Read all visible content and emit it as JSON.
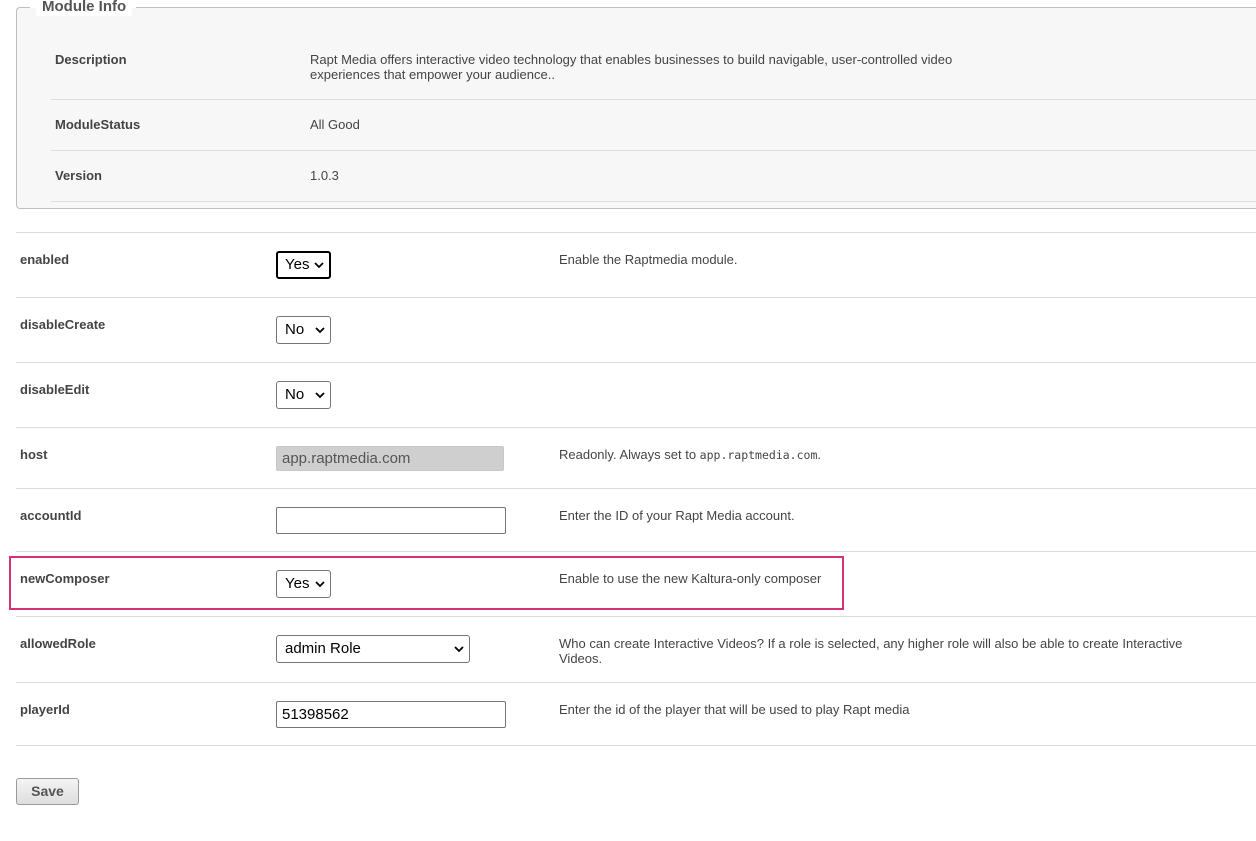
{
  "module_info": {
    "legend": "Module Info",
    "rows": [
      {
        "label": "Description",
        "value": "Rapt Media offers interactive video technology that enables businesses to build navigable, user-controlled video experiences that empower your audience.."
      },
      {
        "label": "ModuleStatus",
        "value": "All Good"
      },
      {
        "label": "Version",
        "value": "1.0.3"
      }
    ]
  },
  "settings": {
    "enabled": {
      "label": "enabled",
      "value": "Yes",
      "help": "Enable the Raptmedia module."
    },
    "disableCreate": {
      "label": "disableCreate",
      "value": "No"
    },
    "disableEdit": {
      "label": "disableEdit",
      "value": "No"
    },
    "host": {
      "label": "host",
      "value": "app.raptmedia.com",
      "help_prefix": "Readonly. Always set to ",
      "help_code": "app.raptmedia.com",
      "help_suffix": "."
    },
    "accountId": {
      "label": "accountId",
      "value": "",
      "help": "Enter the ID of your Rapt Media account."
    },
    "newComposer": {
      "label": "newComposer",
      "value": "Yes",
      "help": "Enable to use the new Kaltura-only composer"
    },
    "allowedRole": {
      "label": "allowedRole",
      "value": "admin Role",
      "help": "Who can create Interactive Videos? If a role is selected, any higher role will also be able to create Interactive Videos."
    },
    "playerId": {
      "label": "playerId",
      "value": "51398562",
      "help": "Enter the id of the player that will be used to play Rapt media"
    }
  },
  "actions": {
    "save_label": "Save"
  },
  "colors": {
    "highlight": "#d6307a"
  }
}
